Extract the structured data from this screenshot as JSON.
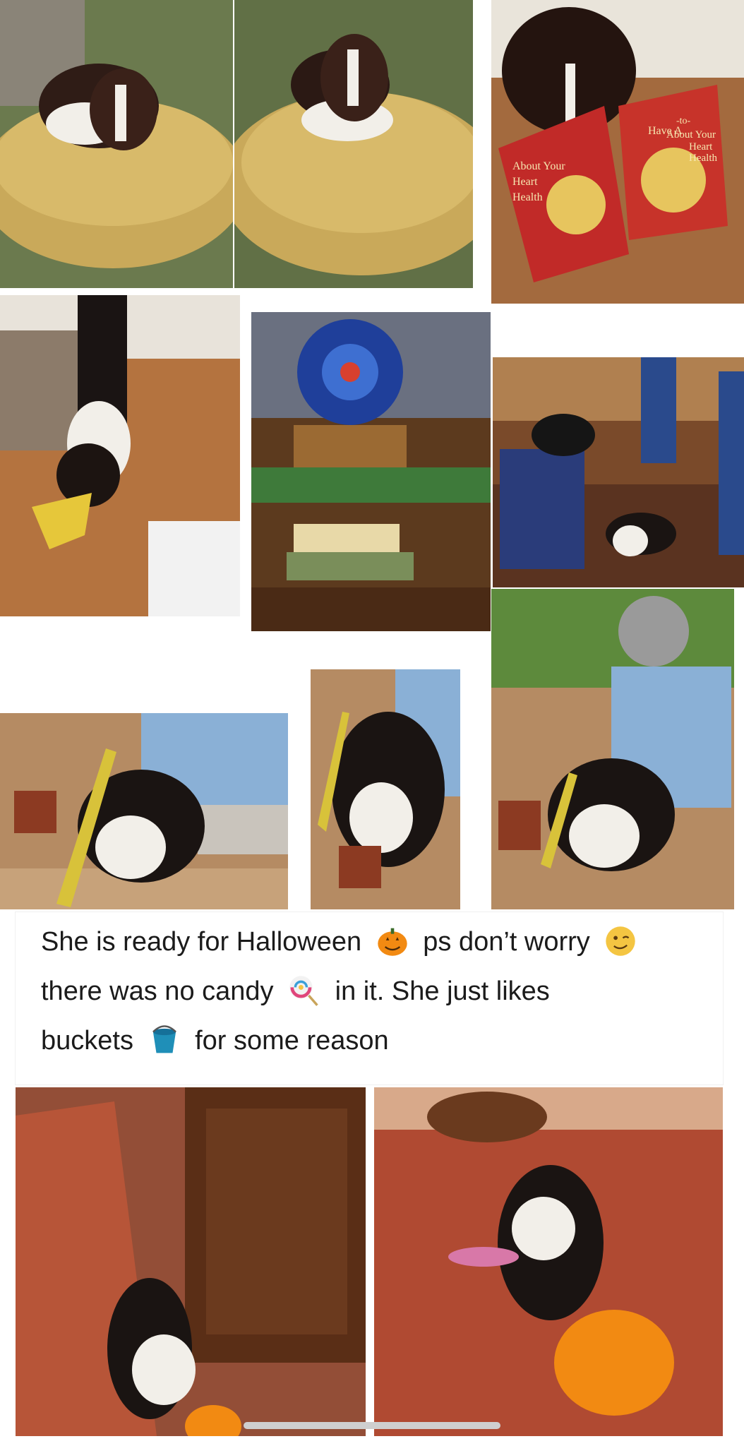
{
  "caption": {
    "line1": {
      "text_a": "She is ready for Halloween",
      "text_b": "ps don’t worry"
    },
    "line2": {
      "text_a": "there was no candy",
      "text_b": "in it. She just likes"
    },
    "line3": {
      "text_a": "buckets",
      "text_b": "for some reason"
    }
  },
  "icons": [
    "pumpkin-icon",
    "wink-icon",
    "lollipop-icon",
    "bucket-icon"
  ],
  "box_text": {
    "line1": "Have A",
    "line2": "-to-",
    "line3": "About Your",
    "line4": "Heart",
    "line5": "Health"
  },
  "colors": {
    "background": "#ffffff",
    "text": "#1b1b1b",
    "pumpkin": "#f28a12",
    "bucket": "#1f8fb8"
  }
}
